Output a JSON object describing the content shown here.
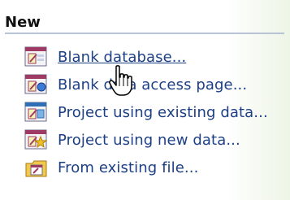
{
  "panel": {
    "section_title": "New",
    "items": [
      {
        "label": "Blank database...",
        "icon": "blank-database-icon"
      },
      {
        "label": "Blank data access page...",
        "icon": "data-access-page-icon"
      },
      {
        "label": "Project using existing data...",
        "icon": "project-existing-data-icon"
      },
      {
        "label": "Project using new data...",
        "icon": "project-new-data-icon"
      },
      {
        "label": "From existing file...",
        "icon": "existing-file-icon"
      }
    ]
  },
  "colors": {
    "link": "#1c3f86",
    "background": "#d8e8c6"
  }
}
